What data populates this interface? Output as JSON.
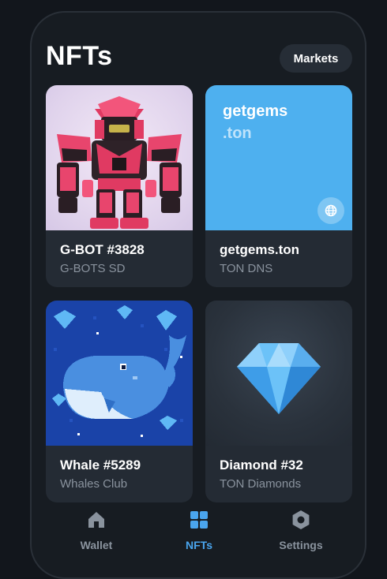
{
  "header": {
    "title": "NFTs",
    "markets_label": "Markets"
  },
  "nfts": [
    {
      "name": "G-BOT #3828",
      "collection": "G-BOTS SD"
    },
    {
      "name": "getgems.ton",
      "collection": "TON DNS",
      "art_line1": "getgems",
      "art_line2": ".ton"
    },
    {
      "name": "Whale #5289",
      "collection": "Whales Club"
    },
    {
      "name": "Diamond #32",
      "collection": "TON Diamonds"
    }
  ],
  "tabs": [
    {
      "label": "Wallet",
      "icon": "home-icon",
      "active": false
    },
    {
      "label": "NFTs",
      "icon": "grid-icon",
      "active": true
    },
    {
      "label": "Settings",
      "icon": "gear-icon",
      "active": false
    }
  ],
  "colors": {
    "background": "#171c22",
    "card": "#242b34",
    "accent": "#4aa5ee",
    "muted": "#8a939e"
  }
}
